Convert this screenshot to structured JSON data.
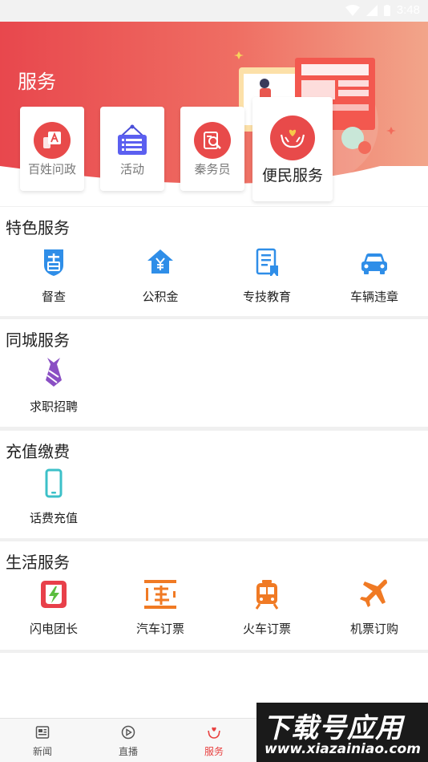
{
  "status_bar": {
    "time": "3:48"
  },
  "header": {
    "title": "服务",
    "quick_actions": [
      {
        "label": "百姓问政",
        "icon": "letter-a-icon"
      },
      {
        "label": "活动",
        "icon": "event-sign-icon"
      },
      {
        "label": "秦务员",
        "icon": "search-document-icon"
      },
      {
        "label": "便民服务",
        "icon": "heart-hands-icon"
      }
    ]
  },
  "sections": [
    {
      "title": "特色服务",
      "items": [
        {
          "label": "督查",
          "icon": "shield-badge-icon"
        },
        {
          "label": "公积金",
          "icon": "house-yuan-icon"
        },
        {
          "label": "专技教育",
          "icon": "document-icon"
        },
        {
          "label": "车辆违章",
          "icon": "car-icon"
        }
      ]
    },
    {
      "title": "同城服务",
      "items": [
        {
          "label": "求职招聘",
          "icon": "necktie-icon"
        }
      ]
    },
    {
      "title": "充值缴费",
      "items": [
        {
          "label": "话费充值",
          "icon": "phone-icon"
        }
      ]
    },
    {
      "title": "生活服务",
      "items": [
        {
          "label": "闪电团长",
          "icon": "lightning-icon"
        },
        {
          "label": "汽车订票",
          "icon": "bus-ticket-icon"
        },
        {
          "label": "火车订票",
          "icon": "train-icon"
        },
        {
          "label": "机票订购",
          "icon": "airplane-icon"
        }
      ]
    }
  ],
  "tab_bar": [
    {
      "label": "新闻",
      "icon": "news-icon"
    },
    {
      "label": "直播",
      "icon": "play-icon"
    },
    {
      "label": "服务",
      "icon": "service-heart-icon",
      "active": true
    }
  ],
  "watermark": {
    "title": "下载号应用",
    "url": "www.xiazainiao.com"
  },
  "colors": {
    "brand_red": "#e8474d",
    "tab_active": "#e8403f"
  }
}
